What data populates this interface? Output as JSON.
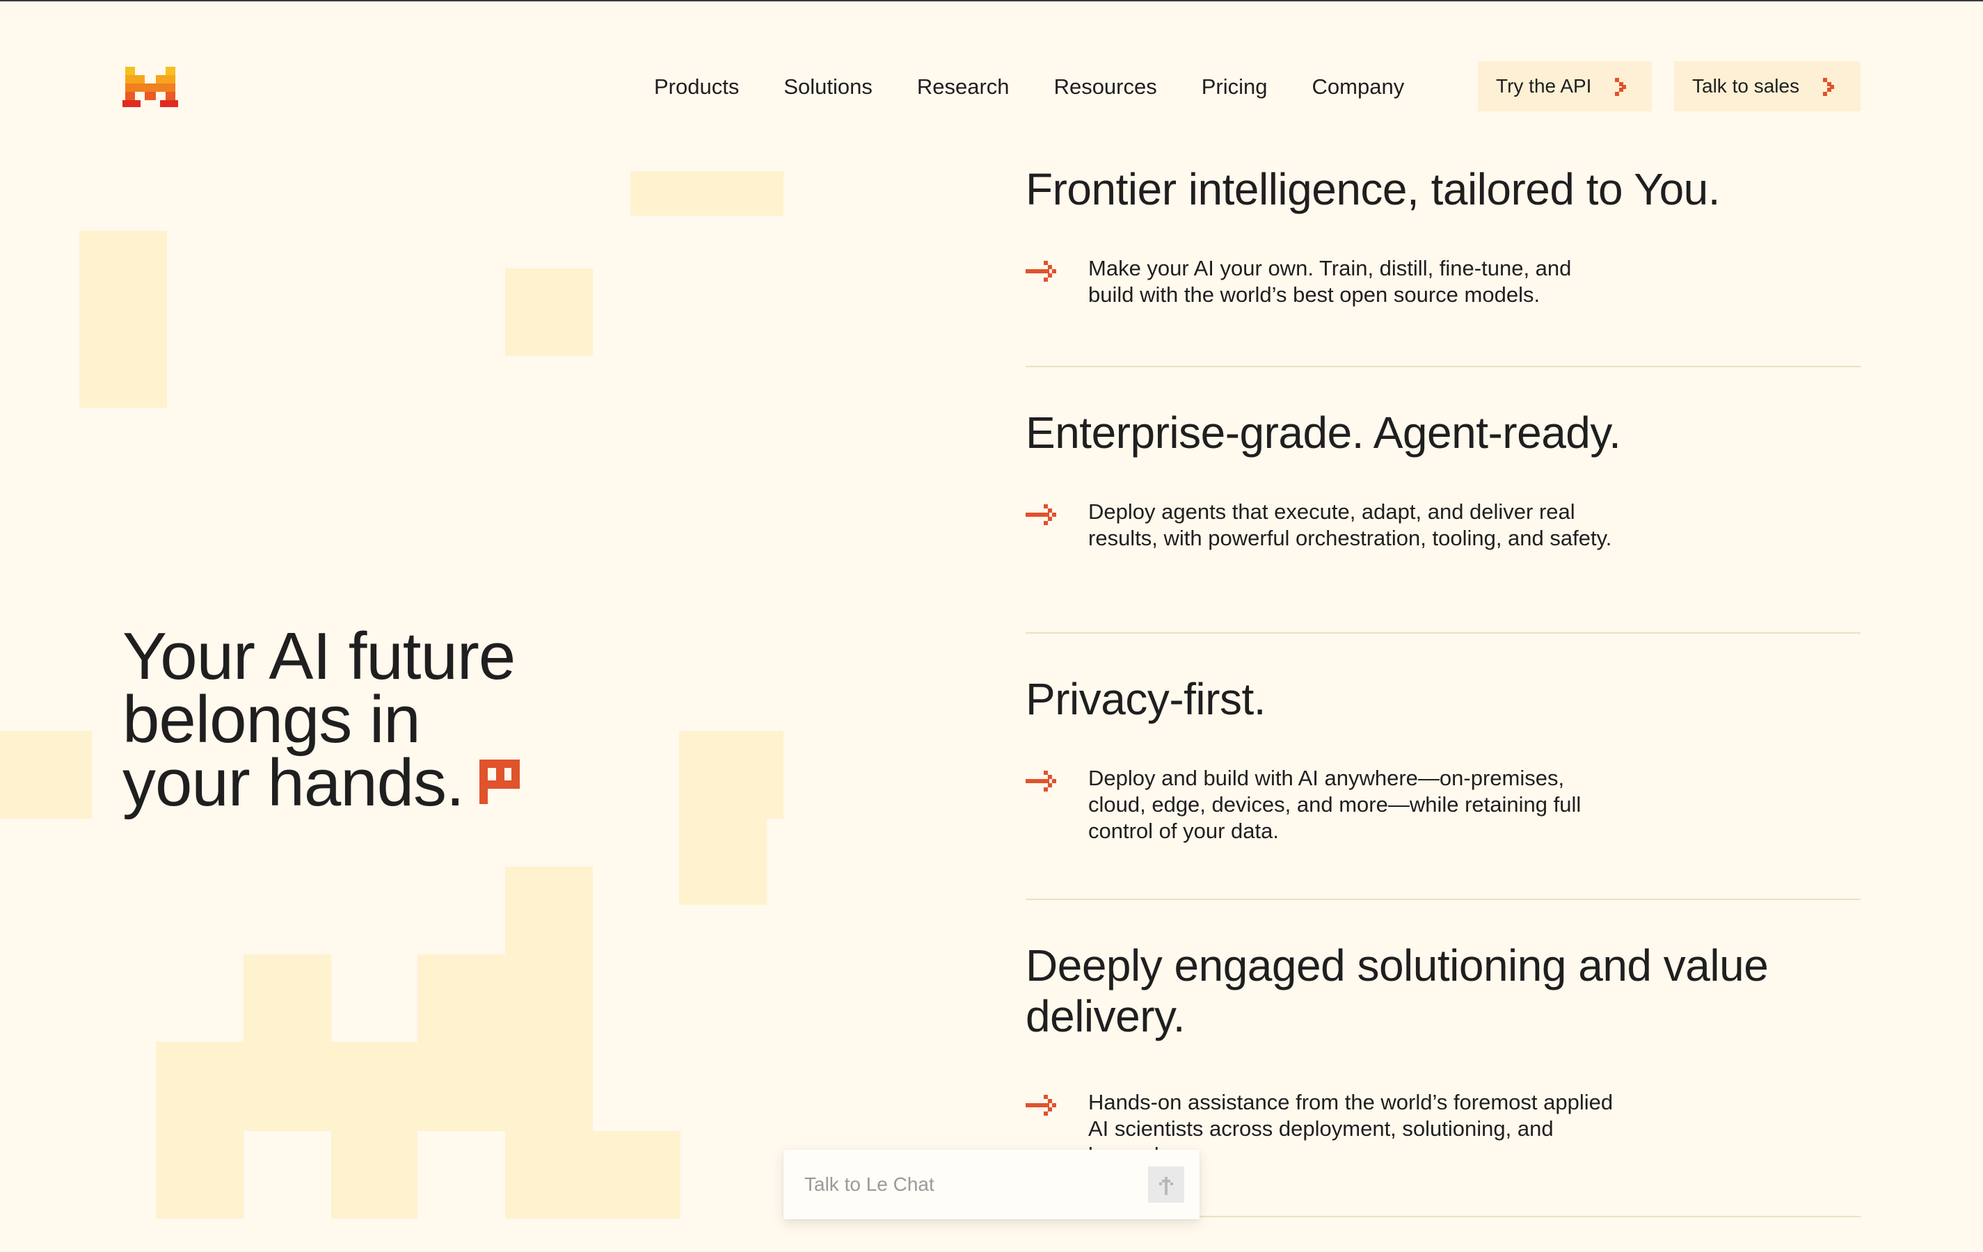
{
  "header": {
    "logo_alt": "Mistral AI",
    "nav": [
      "Products",
      "Solutions",
      "Research",
      "Resources",
      "Pricing",
      "Company"
    ],
    "try_api_label": "Try the API",
    "talk_sales_label": "Talk to sales"
  },
  "hero": {
    "title_lines": [
      "Your AI future",
      "belongs in",
      "your hands."
    ]
  },
  "features": [
    {
      "title": "Frontier intelligence, tailored to You.",
      "text": "Make your AI your own. Train, distill, fine-tune, and build with the world’s best open source models."
    },
    {
      "title": "Enterprise-grade. Agent-ready.",
      "text": "Deploy agents that execute, adapt, and deliver real results, with powerful orchestration, tooling, and safety."
    },
    {
      "title": "Privacy-first.",
      "text": "Deploy and build with AI anywhere—on-premises, cloud, edge, devices, and more—while retaining full control of your data."
    },
    {
      "title": "Deeply engaged solutioning and value delivery.",
      "text": "Hands-on assistance from the world’s foremost applied AI scientists across deployment, solutioning, and beyond."
    }
  ],
  "chat": {
    "placeholder": "Talk to Le Chat"
  },
  "colors": {
    "background": "#fff9ee",
    "accent": "#e0532b",
    "block": "#fff2cf",
    "button_bg": "#fdf0d4",
    "divider": "#e4e4c4"
  },
  "icons": {
    "logo": "mistral-pixel-logo",
    "flag": "pixel-flag-icon",
    "bullet": "arrow-right-icon",
    "button_chevron": "chevron-right-icon",
    "send": "arrow-up-icon"
  }
}
